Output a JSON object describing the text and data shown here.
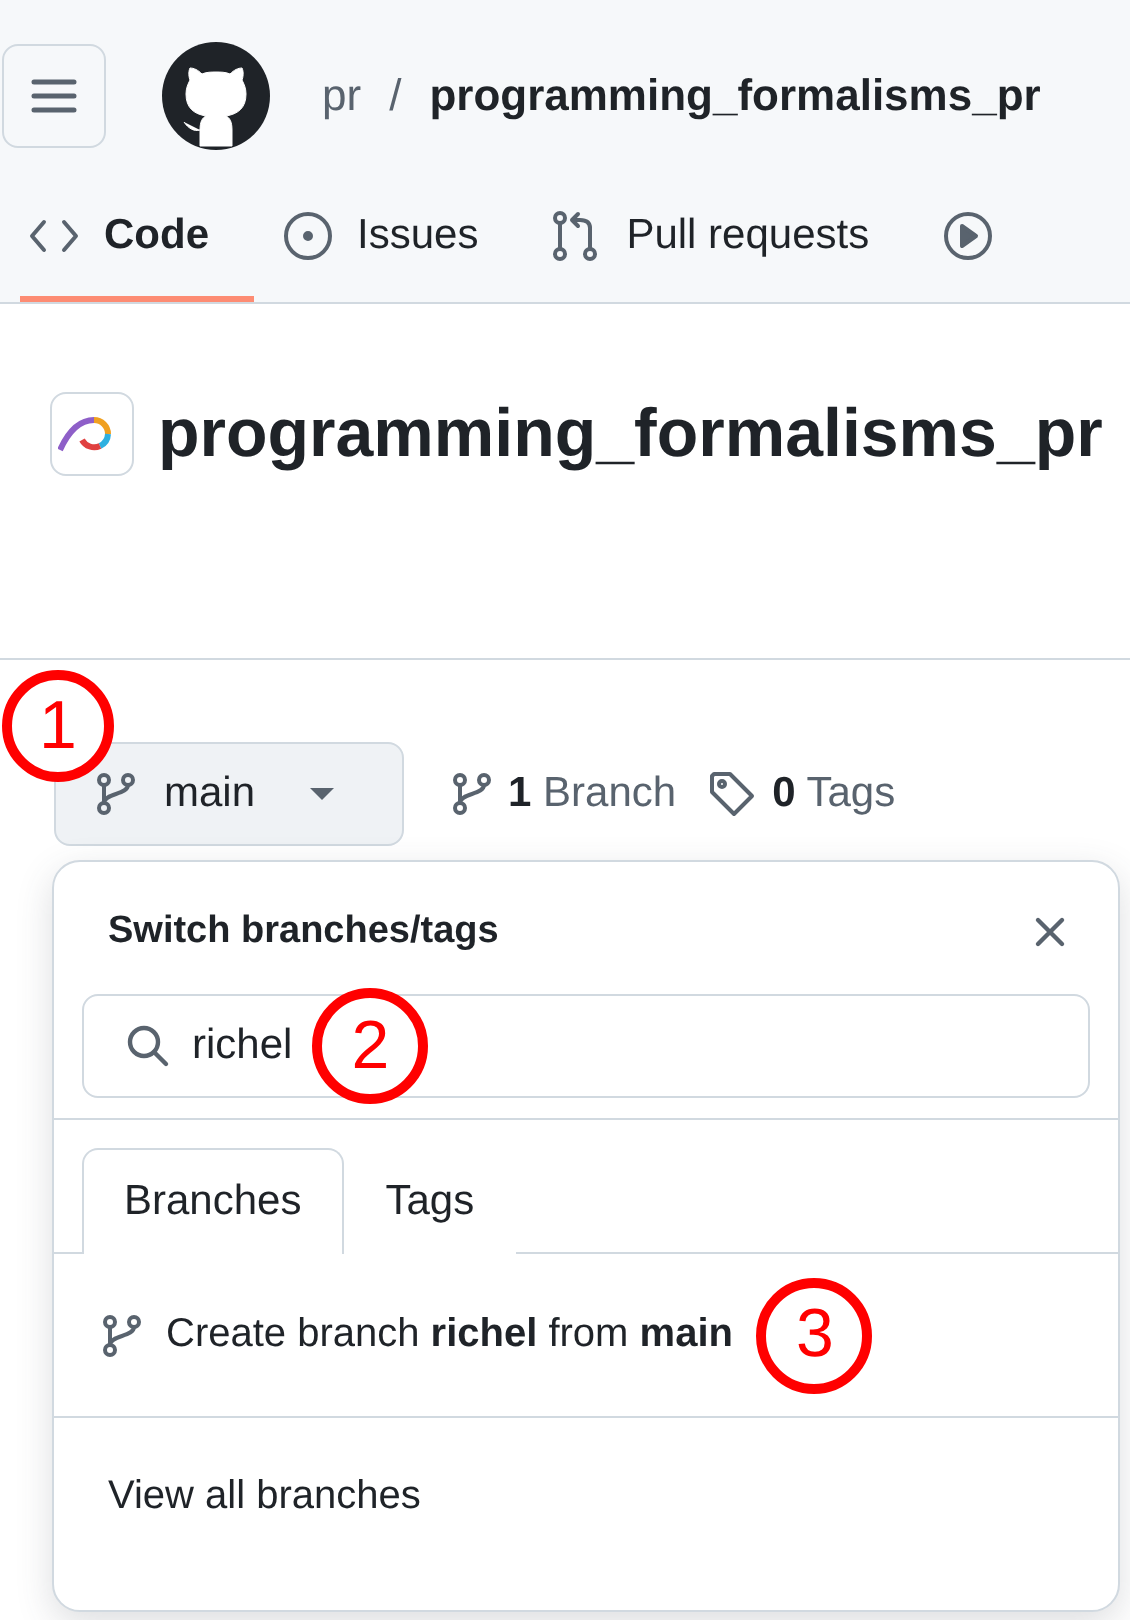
{
  "header": {
    "owner": "pr",
    "separator": "/",
    "repo": "programming_formalisms_pr"
  },
  "nav_tabs": [
    {
      "kind": "code",
      "label": "Code",
      "selected": true
    },
    {
      "kind": "issues",
      "label": "Issues",
      "selected": false
    },
    {
      "kind": "pulls",
      "label": "Pull requests",
      "selected": false
    },
    {
      "kind": "actions",
      "selected": false
    }
  ],
  "repo_title": "programming_formalisms_pr",
  "branch_button": {
    "label": "main",
    "annotation": "1"
  },
  "branch_count": {
    "count": "1",
    "label": "Branch"
  },
  "tag_count": {
    "count": "0",
    "label": "Tags"
  },
  "popover": {
    "title": "Switch branches/tags",
    "search": {
      "value": "richel",
      "annotation": "2"
    },
    "tabs": [
      {
        "label": "Branches",
        "selected": true
      },
      {
        "label": "Tags",
        "selected": false
      }
    ],
    "create_row": {
      "text": "Create branch **richel** from **main**",
      "annotation": "3"
    },
    "footer_link": "View all branches"
  }
}
